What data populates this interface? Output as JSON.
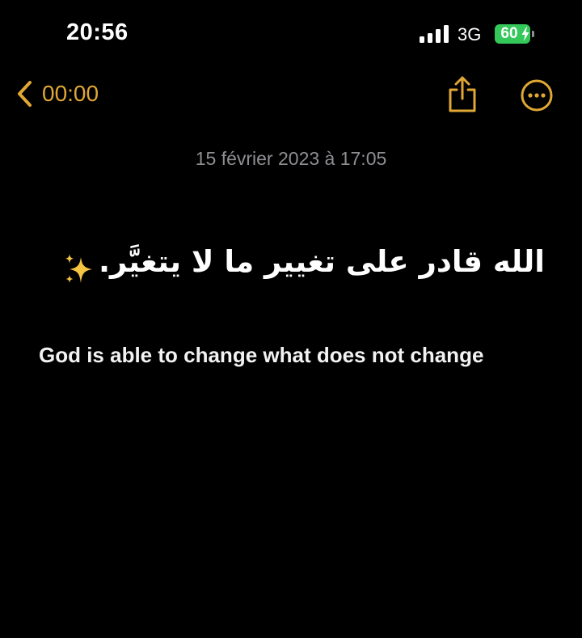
{
  "status_bar": {
    "time": "20:56",
    "network": "3G",
    "battery": "60",
    "icons": [
      "signal-icon",
      "charge-icon"
    ]
  },
  "nav": {
    "back_label": "00:00",
    "icons": [
      "chevron-left-icon",
      "share-icon",
      "more-icon"
    ]
  },
  "note": {
    "date": "15 février 2023 à 17:05",
    "arabic_text": "الله قادر على تغيير ما لا يتغيَّر.",
    "english_text": "God is able to change what does not change",
    "decoration_icon": "sparkles-icon"
  },
  "colors": {
    "background": "#000000",
    "accent": "#e0a735",
    "battery_green": "#34c759",
    "secondary_text": "#8e8e93"
  }
}
